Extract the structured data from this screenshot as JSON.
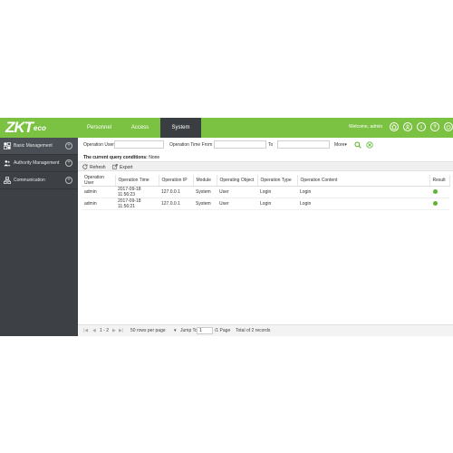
{
  "header": {
    "logo_main": "ZKT",
    "logo_sub": "eco",
    "tabs": [
      {
        "label": "Personnel"
      },
      {
        "label": "Access"
      },
      {
        "label": "System"
      }
    ],
    "welcome": "Welcome, admin",
    "icons": [
      "home-icon",
      "user-icon",
      "info-icon",
      "help-icon",
      "power-icon"
    ]
  },
  "sidebar": {
    "items": [
      {
        "label": "Basic Management",
        "icon": "grid-icon"
      },
      {
        "label": "Authority Management",
        "icon": "users-icon"
      },
      {
        "label": "Communication",
        "icon": "network-icon"
      }
    ]
  },
  "filters": {
    "operation_user_label": "Operation User",
    "operation_user_value": "",
    "time_from_label": "Operation Time From",
    "time_from_value": "",
    "to_label": "To",
    "to_value": "",
    "more_label": "More",
    "conditions_label": "The current query conditions:",
    "conditions_value": " None"
  },
  "toolbar": {
    "refresh_label": "Refresh",
    "export_label": "Export"
  },
  "table": {
    "columns": [
      "Operation User",
      "Operation Time",
      "Operation IP",
      "Module",
      "Operating Object",
      "Operation Type",
      "Operation Content",
      "Result"
    ],
    "rows": [
      {
        "user": "admin",
        "time": "2017-09-18 11:56:23",
        "ip": "127.0.0.1",
        "module": "System",
        "object": "User",
        "type": "Login",
        "content": "Login",
        "result": "success"
      },
      {
        "user": "admin",
        "time": "2017-09-18 11:56:21",
        "ip": "127.0.0.1",
        "module": "System",
        "object": "User",
        "type": "Login",
        "content": "Login",
        "result": "success"
      }
    ]
  },
  "pager": {
    "range": "1 - 2",
    "rows_per_page": "50 rows per page",
    "jump_label": "Jump To",
    "jump_value": "1",
    "page_of": "/1 Page",
    "total": "Total of 2 records"
  },
  "colors": {
    "brand_green": "#7cc242",
    "sidebar_dark": "#3d4146",
    "success_green": "#5bb531"
  }
}
